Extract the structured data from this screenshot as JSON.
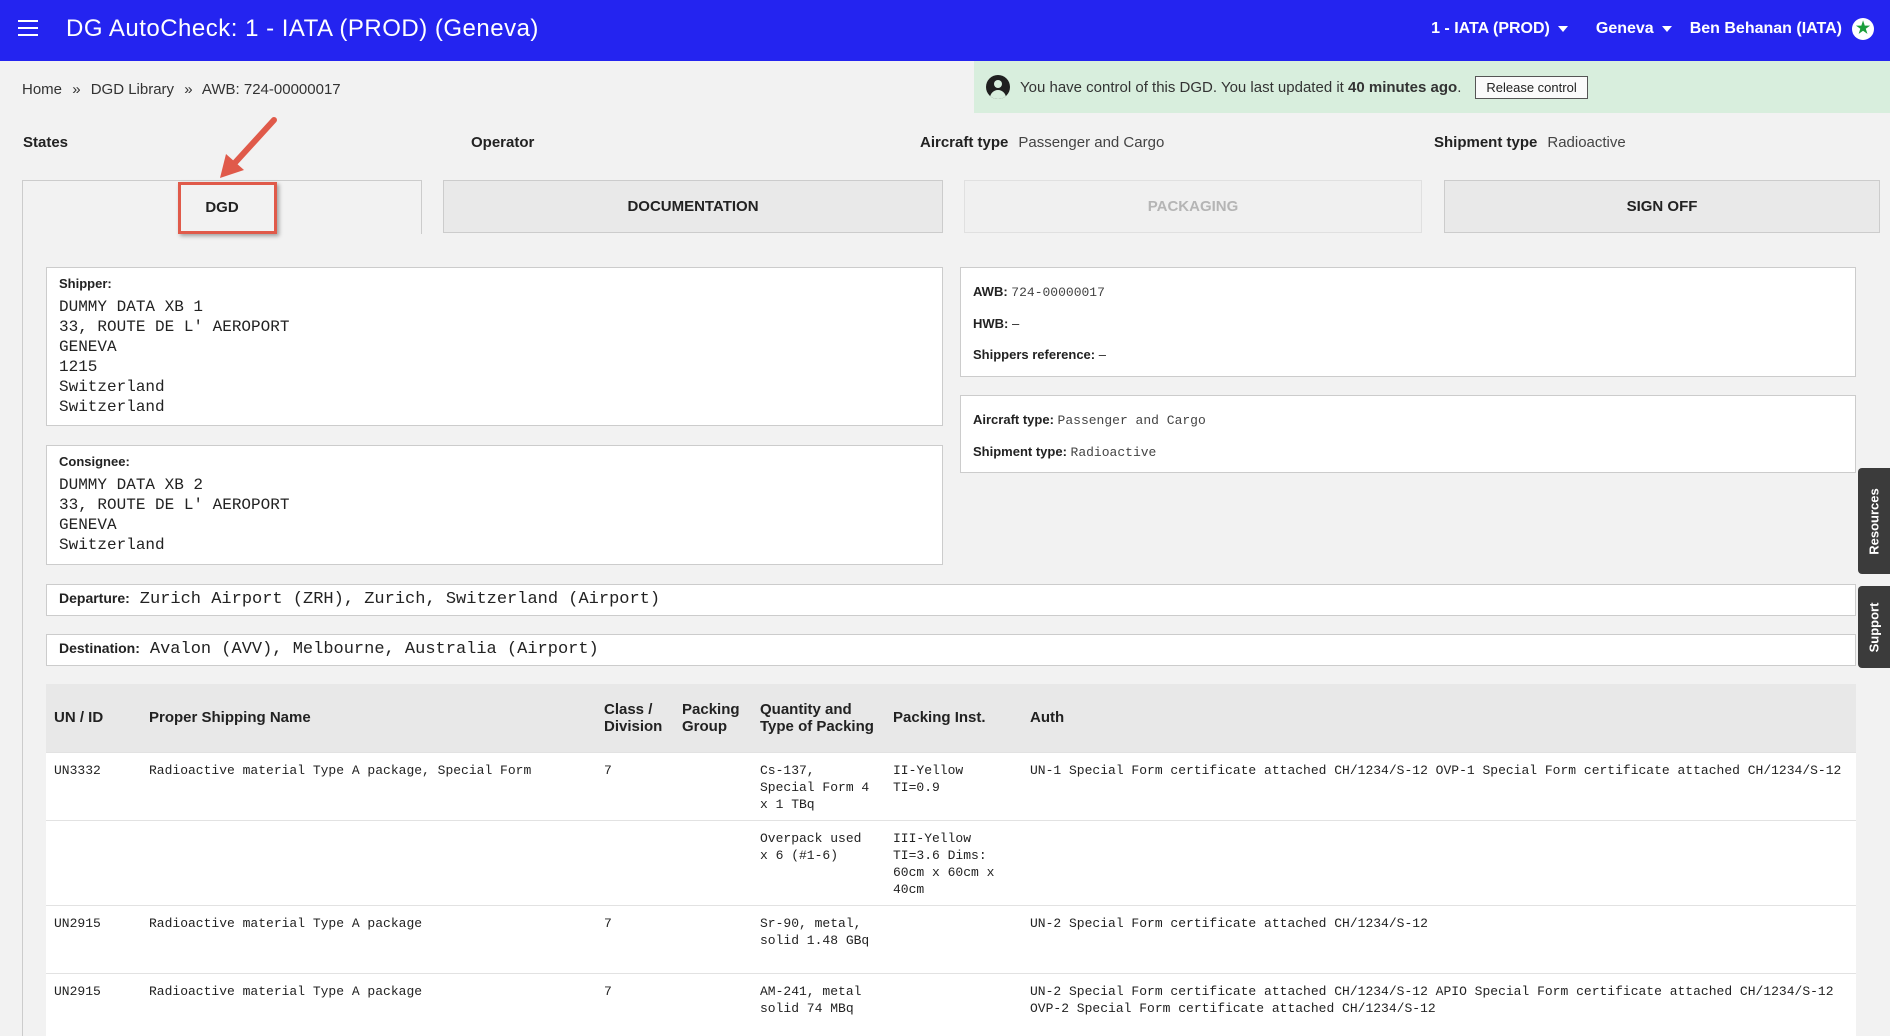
{
  "topbar": {
    "title": "DG AutoCheck: 1 - IATA (PROD) (Geneva)",
    "org_dropdown": "1 - IATA (PROD)",
    "location_dropdown": "Geneva",
    "user_name": "Ben Behanan (IATA)",
    "brand_color": "#2424f0"
  },
  "breadcrumb": {
    "items": [
      "Home",
      "DGD Library",
      "AWB: 724-00000017"
    ],
    "separator": "»"
  },
  "control": {
    "text_prefix": "You have control of this DGD. You last updated it",
    "time": "40 minutes ago",
    "text_suffix": ".",
    "release_label": "Release control"
  },
  "info": {
    "states_label": "States",
    "operator_label": "Operator",
    "aircraft_label": "Aircraft type",
    "aircraft_value": "Passenger and Cargo",
    "shipment_label": "Shipment type",
    "shipment_value": "Radioactive"
  },
  "tabs": [
    "DGD",
    "DOCUMENTATION",
    "PACKAGING",
    "SIGN OFF"
  ],
  "shipper": {
    "label": "Shipper:",
    "lines": [
      "DUMMY DATA XB 1",
      "33, ROUTE DE L' AEROPORT",
      "GENEVA",
      "1215",
      "Switzerland",
      "Switzerland"
    ]
  },
  "consignee": {
    "label": "Consignee:",
    "lines": [
      "DUMMY DATA XB 2",
      "33, ROUTE DE L' AEROPORT",
      "GENEVA",
      "Switzerland"
    ]
  },
  "refs": {
    "awb_label": "AWB:",
    "awb_value": "724-00000017",
    "hwb_label": "HWB:",
    "hwb_value": "–",
    "shipref_label": "Shippers reference:",
    "shipref_value": "–"
  },
  "types": {
    "aircraft_label": "Aircraft type:",
    "aircraft_value": "Passenger and Cargo",
    "shipment_label": "Shipment type:",
    "shipment_value": "Radioactive"
  },
  "departure": {
    "label": "Departure:",
    "value": "Zurich Airport (ZRH), Zurich, Switzerland (Airport)"
  },
  "destination": {
    "label": "Destination:",
    "value": "Avalon (AVV), Melbourne, Australia (Airport)"
  },
  "table": {
    "headers": [
      "UN / ID",
      "Proper Shipping Name",
      "Class / Division",
      "Packing Group",
      "Quantity and Type of Packing",
      "Packing Inst.",
      "Auth"
    ],
    "rows": [
      [
        "UN3332",
        "Radioactive material Type A package, Special Form",
        "7",
        "",
        "Cs-137, Special Form 4 x 1 TBq",
        "II-Yellow TI=0.9",
        "UN-1 Special Form certificate attached CH/1234/S-12 OVP-1 Special Form certificate attached CH/1234/S-12"
      ],
      [
        "",
        "",
        "",
        "",
        "Overpack used x 6 (#1-6)",
        "III-Yellow TI=3.6 Dims: 60cm x 60cm x 40cm",
        ""
      ],
      [
        "UN2915",
        "Radioactive material Type A package",
        "7",
        "",
        "Sr-90, metal, solid 1.48 GBq",
        "",
        "UN-2 Special Form certificate attached CH/1234/S-12"
      ],
      [
        "UN2915",
        "Radioactive material Type A package",
        "7",
        "",
        "AM-241, metal solid 74 MBq",
        "",
        "UN-2 Special Form certificate attached CH/1234/S-12 APIO Special Form certificate attached CH/1234/S-12 OVP-2 Special Form certificate attached CH/1234/S-12"
      ]
    ]
  },
  "side_tabs": [
    "Resources",
    "Support"
  ],
  "icons": {
    "menu": "hamburger-icon",
    "user": "user-circle-icon",
    "star": "star-icon",
    "arrow": "annotation-arrow"
  }
}
